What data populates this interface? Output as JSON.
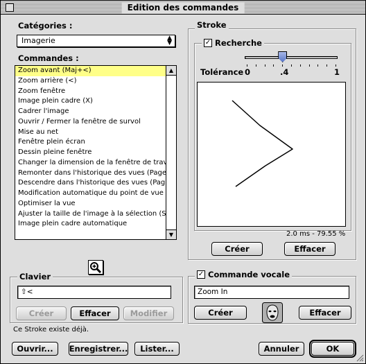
{
  "window": {
    "title": "Edition des commandes"
  },
  "left": {
    "categories_label": "Catégories :",
    "category_selected": "Imagerie",
    "commands_label": "Commandes :",
    "commands": [
      "Zoom avant (Maj+<)",
      "Zoom arrière (<)",
      "Zoom fenêtre",
      "Image plein cadre (X)",
      "Cadrer l'image",
      "Ouvrir / Fermer la fenêtre de survol",
      "Mise au net",
      "Fenêtre plein écran",
      "Dessin pleine fenêtre",
      "Changer la dimension de la fenêtre de travail",
      "Remonter dans l'historique des vues (Page...",
      "Descendre dans l'historique des vues (Pag...",
      "Modification automatique du point de vue",
      "Optimiser la vue",
      "Ajuster la taille de l'image à la sélection (S)",
      "Image plein cadre automatique"
    ],
    "selected_index": 0
  },
  "keyboard": {
    "title": "Clavier",
    "value": "⇧<",
    "create_label": "Créer",
    "clear_label": "Effacer",
    "modify_label": "Modifier"
  },
  "stroke": {
    "title": "Stroke",
    "search_label": "Recherche",
    "search_checked": true,
    "tolerance_label": "Tolérance",
    "tick_labels": [
      "0",
      ".4",
      "1"
    ],
    "tolerance_value": 0.4,
    "info": "2.0 ms - 79.55 %",
    "create_label": "Créer",
    "clear_label": "Effacer"
  },
  "voice": {
    "title": "Commande vocale",
    "checked": true,
    "value": "Zoom In",
    "create_label": "Créer",
    "clear_label": "Effacer"
  },
  "status_text": "Ce Stroke existe déjà.",
  "footer": {
    "open_label": "Ouvrir...",
    "save_label": "Enregistrer...",
    "list_label": "Lister...",
    "cancel_label": "Annuler",
    "ok_label": "OK"
  },
  "icons": {
    "close": "close-box-icon",
    "magnify": "magnifier-icon",
    "voice": "speaking-face-icon",
    "popup": "up-down-arrow-icon",
    "grow": "resize-grip-icon"
  }
}
